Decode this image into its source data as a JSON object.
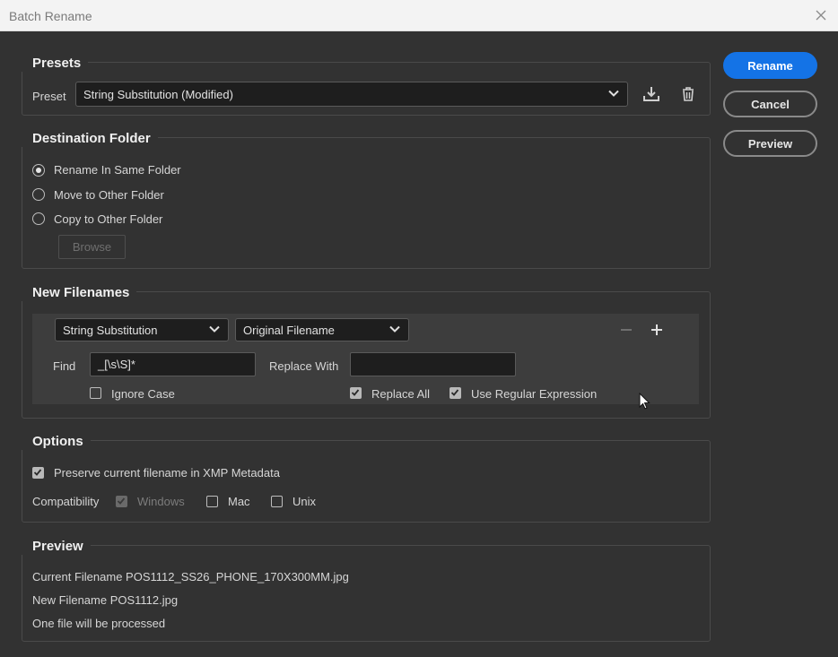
{
  "window": {
    "title": "Batch Rename"
  },
  "actions": {
    "rename": "Rename",
    "cancel": "Cancel",
    "preview": "Preview"
  },
  "presets": {
    "section_title": "Presets",
    "preset_label": "Preset",
    "preset_value": "String Substitution (Modified)"
  },
  "destination": {
    "section_title": "Destination Folder",
    "options": [
      {
        "label": "Rename In Same Folder",
        "selected": true
      },
      {
        "label": "Move to Other Folder",
        "selected": false
      },
      {
        "label": "Copy to Other Folder",
        "selected": false
      }
    ],
    "browse": "Browse"
  },
  "new_filenames": {
    "section_title": "New Filenames",
    "type_value": "String Substitution",
    "source_value": "Original Filename",
    "find_label": "Find",
    "find_value": "_[\\s\\S]*",
    "replace_label": "Replace With",
    "replace_value": "",
    "ignore_case": {
      "label": "Ignore Case",
      "checked": false
    },
    "replace_all": {
      "label": "Replace All",
      "checked": true
    },
    "use_regex": {
      "label": "Use Regular Expression",
      "checked": true
    }
  },
  "options": {
    "section_title": "Options",
    "preserve_xmp": {
      "label": "Preserve current filename in XMP Metadata",
      "checked": true
    },
    "compatibility_label": "Compatibility",
    "windows": {
      "label": "Windows",
      "checked": true,
      "disabled": true
    },
    "mac": {
      "label": "Mac",
      "checked": false
    },
    "unix": {
      "label": "Unix",
      "checked": false
    }
  },
  "preview": {
    "section_title": "Preview",
    "current_filename": "Current Filename POS1112_SS26_PHONE_170X300MM.jpg",
    "new_filename": "New Filename POS1112.jpg",
    "file_count": "One file will be processed"
  },
  "colors": {
    "accent": "#1473e6",
    "background": "#323232",
    "field": "#1e1e1e"
  }
}
